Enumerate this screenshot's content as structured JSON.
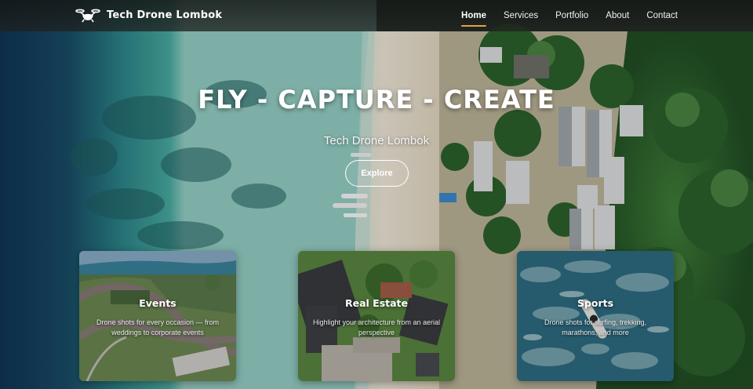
{
  "brand": {
    "name": "Tech Drone Lombok",
    "icon": "drone-icon"
  },
  "nav": {
    "items": [
      {
        "label": "Home",
        "active": true
      },
      {
        "label": "Services",
        "active": false
      },
      {
        "label": "Portfolio",
        "active": false
      },
      {
        "label": "About",
        "active": false
      },
      {
        "label": "Contact",
        "active": false
      }
    ],
    "active_color": "#e9a04a"
  },
  "hero": {
    "title": "FLY - CAPTURE - CREATE",
    "subtitle": "Tech Drone Lombok",
    "cta_label": "Explore"
  },
  "cards": [
    {
      "title": "Events",
      "description": "Drone shots for every occasion — from weddings to corporate events"
    },
    {
      "title": "Real Estate",
      "description": "Highlight your architecture from an aerial perspective"
    },
    {
      "title": "Sports",
      "description": "Drone shots for surfing, trekking, marathons, and more"
    }
  ],
  "colors": {
    "sea_deep": "#13405e",
    "sea_shallow": "#3f9c96",
    "sand": "#e4dccb",
    "forest": "#2f5a2e"
  }
}
